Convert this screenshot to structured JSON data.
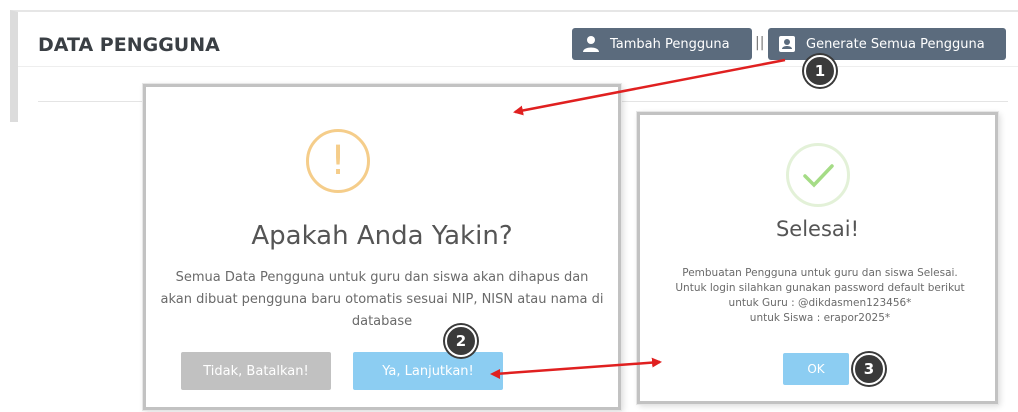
{
  "header": {
    "title": "DATA PENGGUNA",
    "add_user_label": "Tambah Pengguna",
    "separator": "||",
    "generate_all_label": "Generate Semua Pengguna"
  },
  "confirm_dialog": {
    "title": "Apakah Anda Yakin?",
    "message": "Semua Data Pengguna untuk guru dan siswa akan dihapus dan akan dibuat pengguna baru otomatis sesuai NIP, NISN atau nama di database",
    "cancel_label": "Tidak, Batalkan!",
    "confirm_label": "Ya, Lanjutkan!"
  },
  "success_dialog": {
    "title": "Selesai!",
    "message_lines": [
      "Pembuatan Pengguna untuk guru dan siswa Selesai.",
      "Untuk login silahkan gunakan password default berikut",
      "untuk Guru : @dikdasmen123456*",
      "untuk Siswa : erapor2025*"
    ],
    "ok_label": "OK"
  },
  "steps": [
    "1",
    "2",
    "3"
  ],
  "icons": {
    "add_user": "user-icon",
    "generate": "id-card-icon",
    "warning": "exclamation-circle-icon",
    "success": "checkmark-circle-icon"
  },
  "colors": {
    "dark_button": "#5b6b7d",
    "primary": "#8ccdf2",
    "cancel": "#c1c1c1",
    "warning": "#f5cd8a",
    "success": "#a5dc86",
    "arrow": "#e02020"
  }
}
